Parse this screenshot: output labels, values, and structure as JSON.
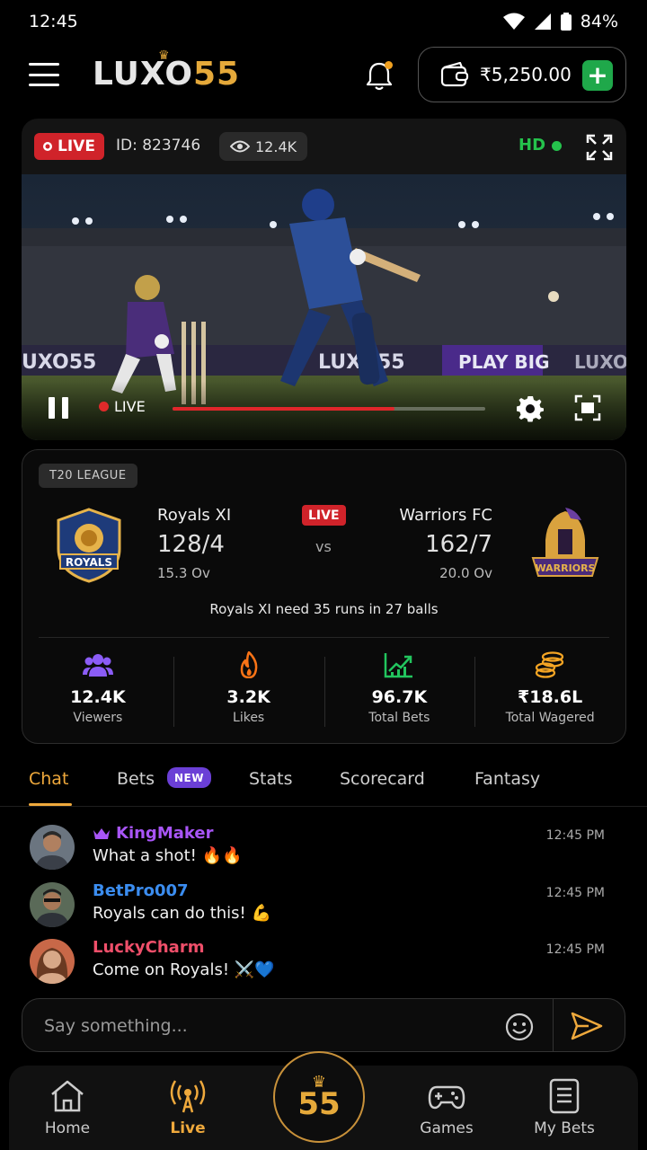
{
  "status_bar": {
    "time": "12:45",
    "battery": "84%"
  },
  "header": {
    "logo_main": "LUXO",
    "logo_num": "55",
    "balance": "₹5,250.00"
  },
  "stream": {
    "live_label": "LIVE",
    "id": "ID: 823746",
    "viewers": "12.4K",
    "quality": "HD",
    "control_live_label": "LIVE",
    "progress": 0.71
  },
  "match": {
    "league": "T20 LEAGUE",
    "status": "LIVE",
    "vs": "vs",
    "home": {
      "name": "Royals XI",
      "score": "128/4",
      "overs": "15.3 Ov",
      "logo_text": "ROYALS"
    },
    "away": {
      "name": "Warriors FC",
      "score": "162/7",
      "overs": "20.0 Ov",
      "logo_text": "WARRIORS"
    },
    "need_text": "Royals XI need 35 runs in 27 balls",
    "stats": [
      {
        "icon": "users-icon",
        "value": "12.4K",
        "label": "Viewers",
        "color": "#8b5cf6"
      },
      {
        "icon": "fire-icon",
        "value": "3.2K",
        "label": "Likes",
        "color": "#f97316"
      },
      {
        "icon": "chart-up-icon",
        "value": "96.7K",
        "label": "Total Bets",
        "color": "#22c55e"
      },
      {
        "icon": "coins-icon",
        "value": "₹18.6L",
        "label": "Total Wagered",
        "color": "#f5a524"
      }
    ]
  },
  "tabs": [
    {
      "label": "Chat",
      "active": true
    },
    {
      "label": "Bets",
      "badge": "NEW"
    },
    {
      "label": "Stats"
    },
    {
      "label": "Scorecard"
    },
    {
      "label": "Fantasy"
    }
  ],
  "chat": [
    {
      "user": "KingMaker",
      "color": "#a855f7",
      "vip": true,
      "text": "What a shot! 🔥🔥",
      "time": "12:45 PM"
    },
    {
      "user": "BetPro007",
      "color": "#3b8df0",
      "vip": false,
      "text": "Royals can do this! 💪",
      "time": "12:45 PM"
    },
    {
      "user": "LuckyCharm",
      "color": "#ef4f6a",
      "vip": false,
      "text": "Come on Royals! ⚔️💙",
      "time": "12:45 PM"
    }
  ],
  "chat_input": {
    "placeholder": "Say something..."
  },
  "bottom_nav": [
    {
      "label": "Home",
      "icon": "home-icon"
    },
    {
      "label": "Live",
      "icon": "broadcast-icon",
      "active": true
    },
    {
      "center": "55"
    },
    {
      "label": "Games",
      "icon": "gamepad-icon"
    },
    {
      "label": "My Bets",
      "icon": "receipt-icon"
    }
  ],
  "colors": {
    "accent": "#efa93c",
    "live_red": "#d0232a",
    "positive_green": "#25c24c"
  }
}
